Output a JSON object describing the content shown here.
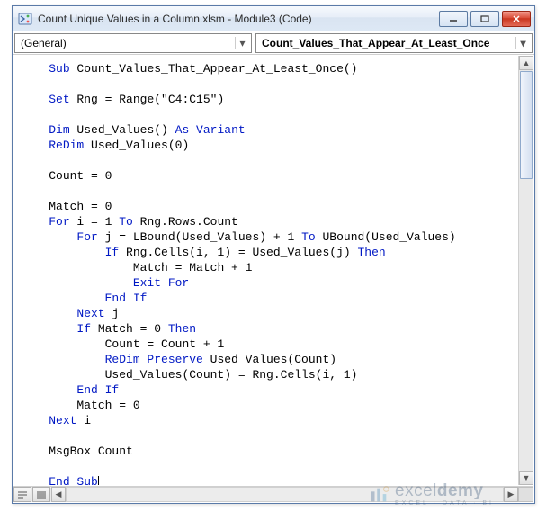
{
  "window": {
    "title": "Count Unique Values in a Column.xlsm - Module3 (Code)"
  },
  "dropdowns": {
    "object": "(General)",
    "procedure": "Count_Values_That_Appear_At_Least_Once"
  },
  "watermark": {
    "brand_prefix": "excel",
    "brand_suffix": "demy",
    "tagline": "EXCEL · DATA · BI"
  },
  "code": {
    "l01a": "Sub",
    "l01b": " Count_Values_That_Appear_At_Least_Once()",
    "l03a": "Set",
    "l03b": " Rng = Range(\"C4:C15\")",
    "l05a": "Dim",
    "l05b": " Used_Values() ",
    "l05c": "As Variant",
    "l06a": "ReDim",
    "l06b": " Used_Values(0)",
    "l08": "Count = 0",
    "l10": "Match = 0",
    "l11a": "For",
    "l11b": " i = 1 ",
    "l11c": "To",
    "l11d": " Rng.Rows.Count",
    "l12a": "For",
    "l12b": " j = LBound(Used_Values) + 1 ",
    "l12c": "To",
    "l12d": " UBound(Used_Values)",
    "l13a": "If",
    "l13b": " Rng.Cells(i, 1) = Used_Values(j) ",
    "l13c": "Then",
    "l14": "Match = Match + 1",
    "l15": "Exit For",
    "l16": "End If",
    "l17a": "Next",
    "l17b": " j",
    "l18a": "If",
    "l18b": " Match = 0 ",
    "l18c": "Then",
    "l19": "Count = Count + 1",
    "l20a": "ReDim Preserve",
    "l20b": " Used_Values(Count)",
    "l21": "Used_Values(Count) = Rng.Cells(i, 1)",
    "l22": "End If",
    "l23": "Match = 0",
    "l24a": "Next",
    "l24b": " i",
    "l26": "MsgBox Count",
    "l28": "End Sub",
    "indent1": "    ",
    "indent2": "        ",
    "indent3": "            ",
    "indent4": "                "
  }
}
